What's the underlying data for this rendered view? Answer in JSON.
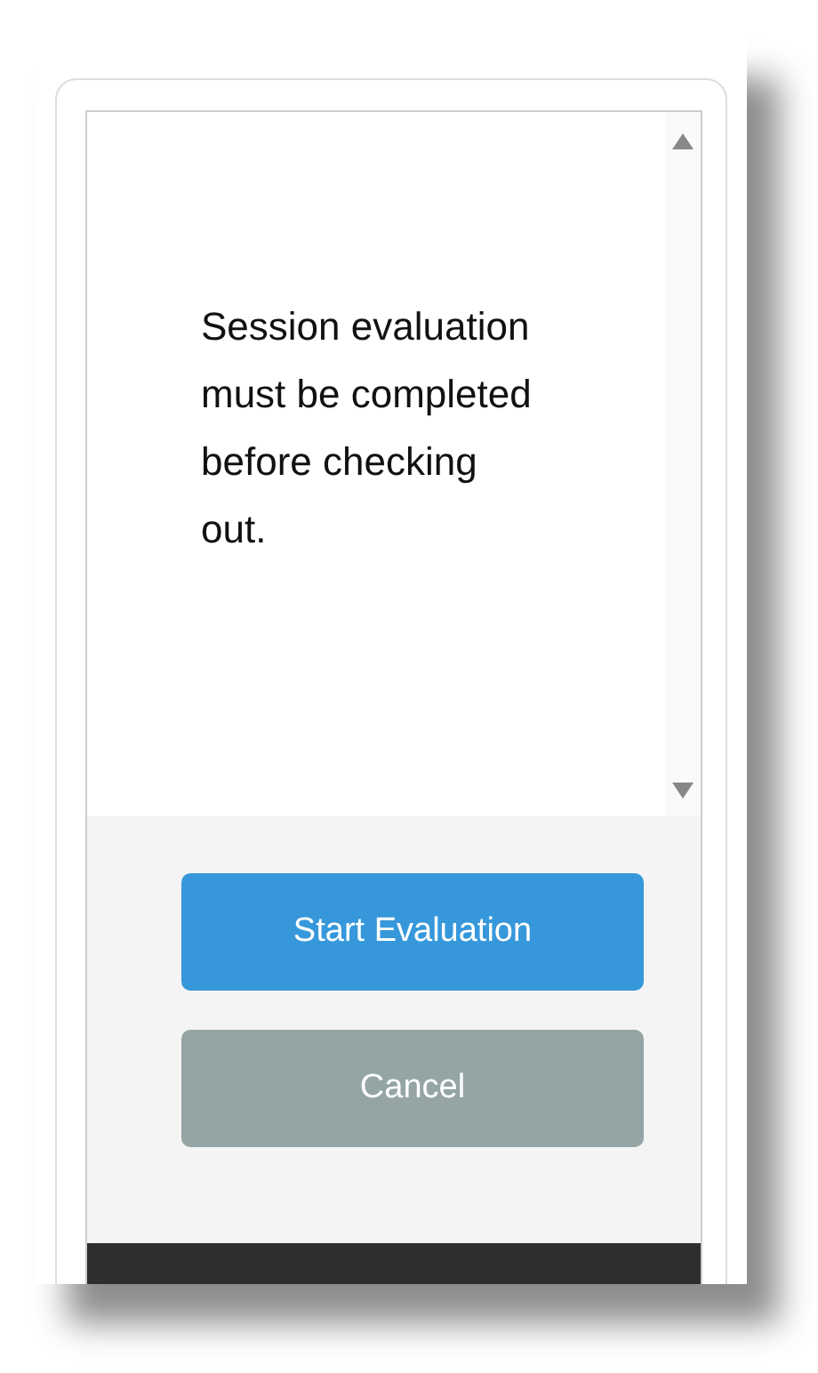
{
  "message": "Session evaluation must be completed before checking out.",
  "buttons": [
    {
      "label": "Start Evaluation",
      "kind": "primary"
    },
    {
      "label": "Cancel",
      "kind": "secondary"
    }
  ]
}
